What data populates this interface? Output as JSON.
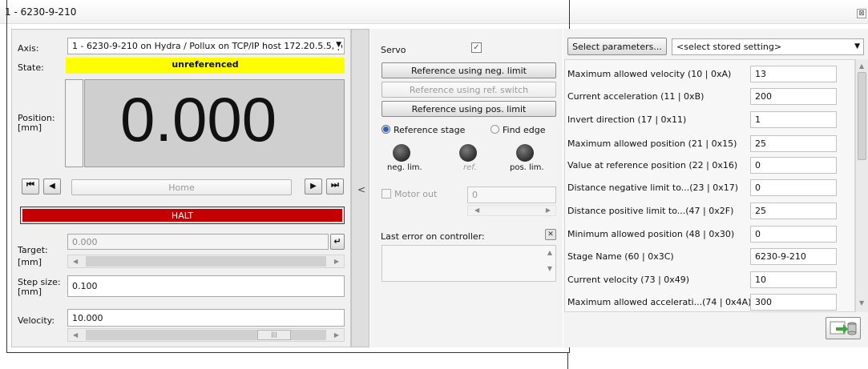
{
  "window": {
    "title": "1 - 6230-9-210"
  },
  "left": {
    "axis_label": "Axis:",
    "axis_value": "1 - 6230-9-210 on Hydra / Pollux on TCP/IP host 172.20.5.5, p",
    "state_label": "State:",
    "state_value": "unreferenced",
    "position_label": "Position:\n[mm]",
    "position_value": "0.000",
    "home_label": "Home",
    "halt_label": "HALT",
    "target_label": "Target:\n[mm]",
    "target_value": "0.000",
    "step_label": "Step size:\n[mm]",
    "step_value": "0.100",
    "velocity_label": "Velocity:",
    "velocity_value": "10.000",
    "collapse_glyph": "<"
  },
  "middle": {
    "servo_label": "Servo",
    "servo_checked": true,
    "ref_neg_label": "Reference using neg. limit",
    "ref_switch_label": "Reference using ref. switch",
    "ref_pos_label": "Reference using pos. limit",
    "radio_ref_stage": "Reference stage",
    "radio_find_edge": "Find edge",
    "led_neg": "neg. lim.",
    "led_ref": "ref.",
    "led_pos": "pos. lim.",
    "motor_out_label": "Motor out",
    "motor_out_value": "0",
    "last_error_label": "Last error on controller:"
  },
  "right": {
    "select_params_label": "Select parameters...",
    "stored_setting": "<select stored setting>",
    "params": [
      {
        "label": "Maximum allowed velocity  (10 | 0xA)",
        "value": "13"
      },
      {
        "label": "Current acceleration  (11 | 0xB)",
        "value": "200"
      },
      {
        "label": "Invert direction  (17 | 0x11)",
        "value": "1"
      },
      {
        "label": "Maximum allowed position  (21 | 0x15)",
        "value": "25"
      },
      {
        "label": "Value at reference position  (22 | 0x16)",
        "value": "0"
      },
      {
        "label": "Distance negative limit to...(23 | 0x17)",
        "value": "0"
      },
      {
        "label": "Distance positive limit to...(47 | 0x2F)",
        "value": "25"
      },
      {
        "label": "Minimum allowed position  (48 | 0x30)",
        "value": "0"
      },
      {
        "label": "Stage Name  (60 | 0x3C)",
        "value": "6230-9-210"
      },
      {
        "label": "Current velocity  (73 | 0x49)",
        "value": "10"
      },
      {
        "label": "Maximum allowed accelerati...(74 | 0x4A)",
        "value": "300"
      }
    ]
  }
}
